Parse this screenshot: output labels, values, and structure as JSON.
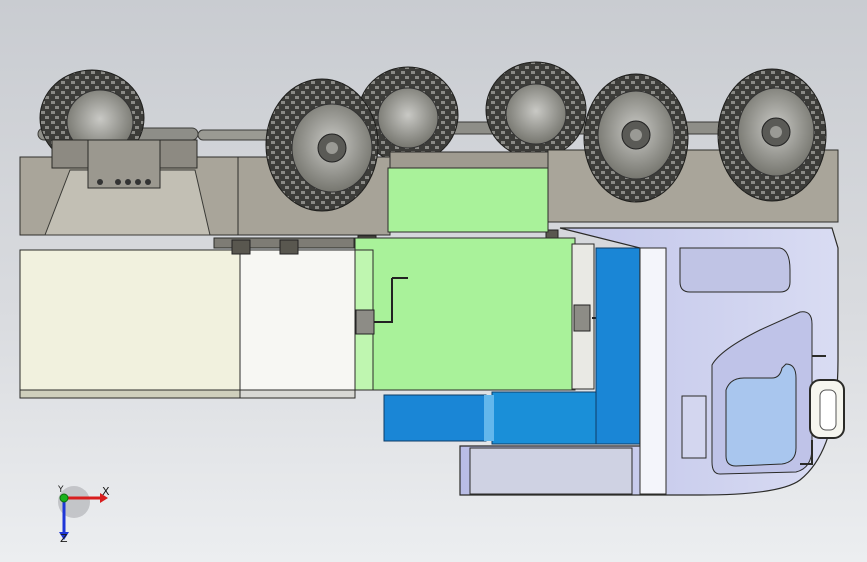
{
  "viewport": {
    "background_top": "#c9ccd1",
    "background_bottom": "#eceef0"
  },
  "model": {
    "colors": {
      "chassis": "#a9a59a",
      "tire": "#3a3a38",
      "rim": "#8c8c8a",
      "box_cream": "#f1f1de",
      "box_white": "#f7f7f3",
      "box_green": "#a9f29a",
      "box_green_light": "#bff6b0",
      "tank_blue": "#1a86d6",
      "cab": "#c7cbeb",
      "cab_window": "#a9c6ee"
    }
  },
  "triad": {
    "x_label": "X",
    "y_label": "Y",
    "z_label": "Z",
    "x_color": "#d81e1e",
    "y_color": "#1bb21b",
    "z_color": "#1e36d8"
  }
}
